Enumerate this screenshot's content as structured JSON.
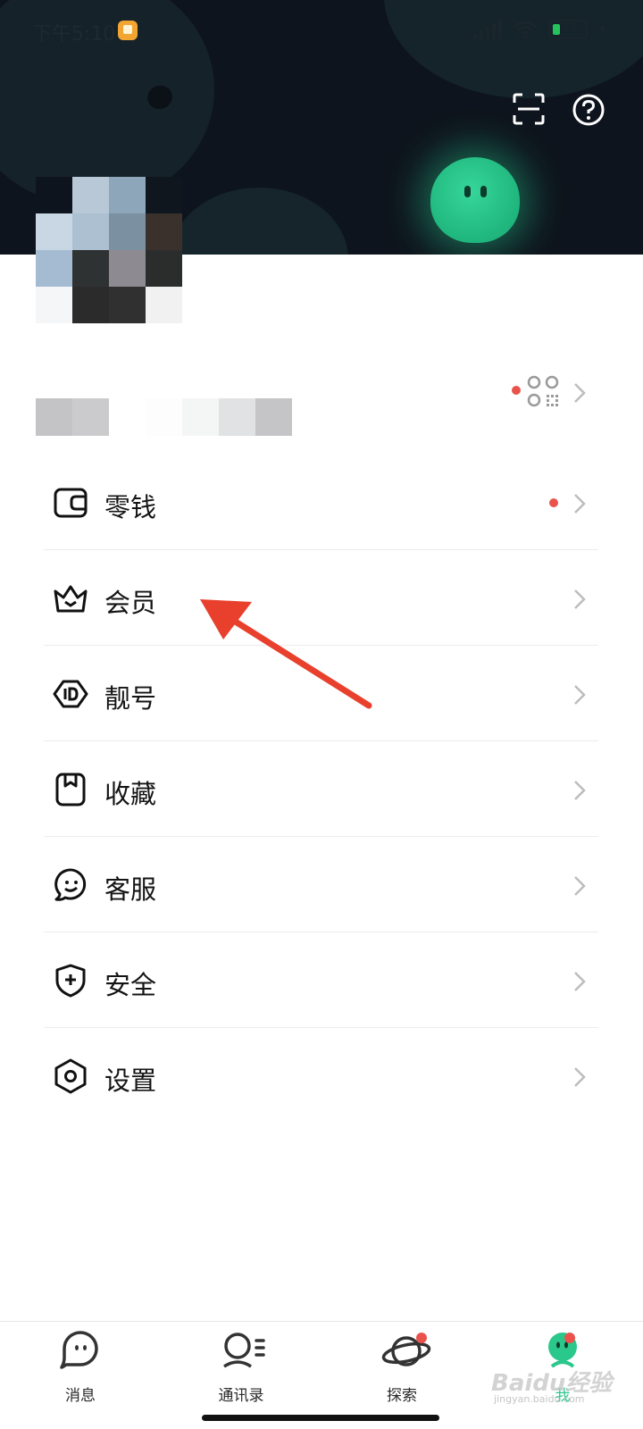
{
  "status_bar": {
    "time": "下午5:10",
    "battery": "20"
  },
  "header": {
    "scan_icon": "scan-icon",
    "help_icon": "help-icon"
  },
  "profile": {
    "qr_icon": "qr-code-icon"
  },
  "menu": {
    "items": [
      {
        "label": "零钱",
        "icon": "wallet-icon",
        "badge": true
      },
      {
        "label": "会员",
        "icon": "crown-icon",
        "badge": false
      },
      {
        "label": "靓号",
        "icon": "id-badge-icon",
        "badge": false
      },
      {
        "label": "收藏",
        "icon": "bookmark-icon",
        "badge": false
      },
      {
        "label": "客服",
        "icon": "customer-service-icon",
        "badge": false
      },
      {
        "label": "安全",
        "icon": "shield-icon",
        "badge": false
      },
      {
        "label": "设置",
        "icon": "settings-icon",
        "badge": false
      }
    ]
  },
  "tabbar": {
    "tabs": [
      {
        "label": "消息",
        "icon": "message-icon",
        "badge": false
      },
      {
        "label": "通讯录",
        "icon": "contacts-icon",
        "badge": false
      },
      {
        "label": "探索",
        "icon": "planet-icon",
        "badge": true
      },
      {
        "label": "我",
        "icon": "me-mascot-icon",
        "badge": true,
        "active": true
      }
    ]
  },
  "watermark": {
    "text": "Baidu经验",
    "sub": "jingyan.baidu.com"
  },
  "colors": {
    "accent": "#2bc88b",
    "badge": "#e9534b",
    "header_bg": "#0e141d",
    "annotation_arrow": "#e8402c"
  }
}
